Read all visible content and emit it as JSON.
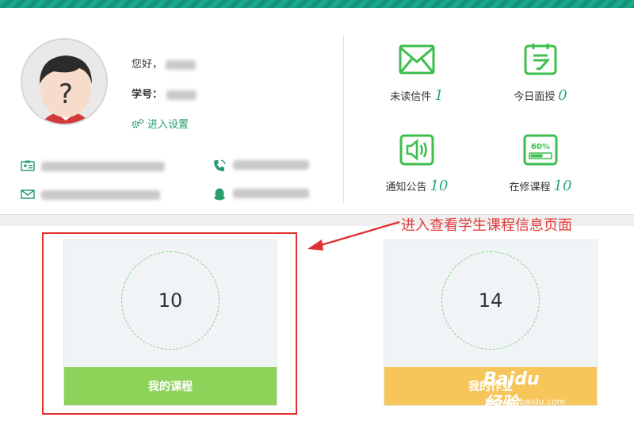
{
  "profile": {
    "greeting_label": "您好，",
    "student_id_label": "学号：",
    "settings_label": "进入设置"
  },
  "stats": [
    {
      "label": "未读信件",
      "value": "1",
      "icon": "envelope-icon"
    },
    {
      "label": "今日面授",
      "value": "0",
      "icon": "calendar-icon"
    },
    {
      "label": "通知公告",
      "value": "10",
      "icon": "speaker-icon"
    },
    {
      "label": "在修课程",
      "value": "10",
      "icon": "progress-icon",
      "icon_text": "60%"
    }
  ],
  "cards": [
    {
      "count": "10",
      "label": "我的课程",
      "bar_color": "#8dd35a"
    },
    {
      "count": "14",
      "label": "我的作业",
      "bar_color": "#f6c65b"
    }
  ],
  "annotation": "进入查看学生课程信息页面",
  "watermark": {
    "brand": "Baidu经验",
    "url": "jingyan.baidu.com"
  },
  "colors": {
    "accent": "#2aa57a",
    "icon_green": "#3cbf4c",
    "highlight": "#e03030"
  }
}
